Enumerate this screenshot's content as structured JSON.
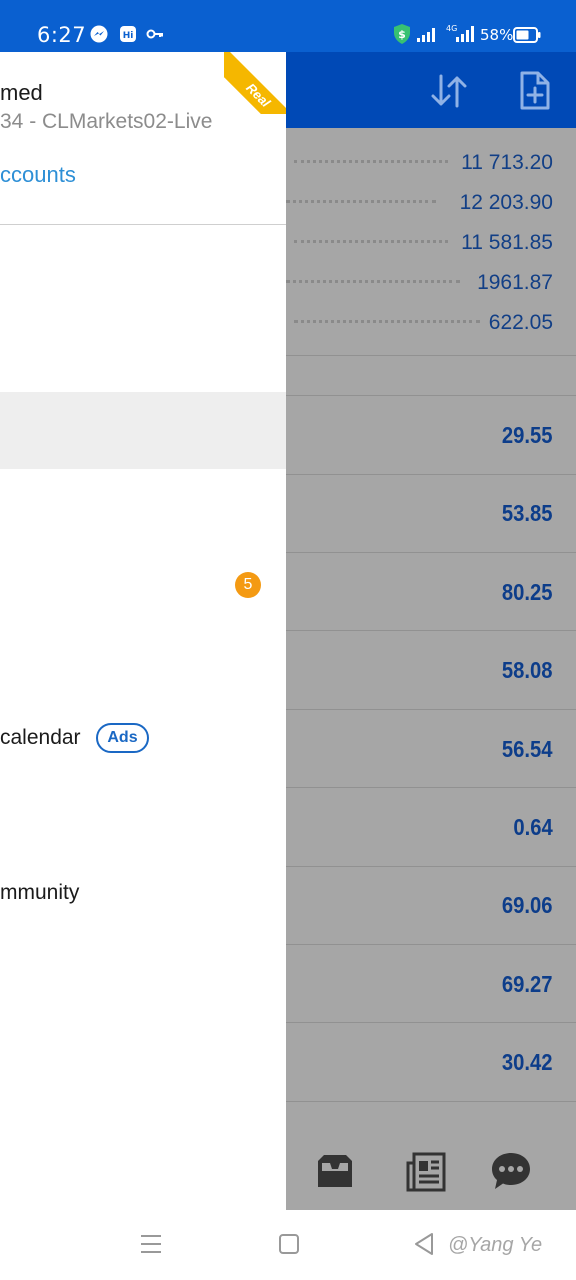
{
  "status_bar": {
    "time": "6:27",
    "battery_percent": "58%",
    "network_label": "4G",
    "icons": [
      "messenger-icon",
      "hi-app-icon",
      "key-icon",
      "shield-dollar-icon",
      "signal-icon",
      "signal-4g-icon",
      "battery-icon"
    ]
  },
  "toolbar": {
    "icons": [
      "sort-icon",
      "add-document-icon"
    ]
  },
  "quotes": [
    {
      "value": "11 713.20"
    },
    {
      "value": "12 203.90"
    },
    {
      "value": "11 581.85"
    },
    {
      "value": "1961.87"
    },
    {
      "value": "622.05"
    }
  ],
  "deals": [
    {
      "value": "29.55"
    },
    {
      "value": "53.85"
    },
    {
      "value": "80.25"
    },
    {
      "value": "58.08"
    },
    {
      "value": "56.54"
    },
    {
      "value": "0.64"
    },
    {
      "value": "69.06"
    },
    {
      "value": "69.27"
    },
    {
      "value": "30.42"
    }
  ],
  "drawer": {
    "ribbon_label": "Real",
    "account_name": "med",
    "account_server": "34 - CLMarkets02-Live",
    "accounts_link": "ccounts",
    "badge_count": "5",
    "menu_items": [
      {
        "label": "calendar"
      },
      {
        "label": "mmunity"
      }
    ],
    "ads_label": "Ads"
  },
  "bottom_nav": {
    "icons": [
      "mailbox-icon",
      "news-icon",
      "chat-icon"
    ]
  },
  "sys_nav": {
    "watermark": "@Yang Ye",
    "icons": [
      "menu-icon",
      "home-icon",
      "back-icon"
    ]
  },
  "colors": {
    "status_bar": "#0a60d0",
    "toolbar": "#0049b6",
    "dim_overlay": "#a6a6a6",
    "quote_text": "#123f86",
    "deal_text": "#0d3d8a",
    "link": "#2d8fd6",
    "badge": "#f49a13",
    "ribbon": "#f5b700"
  }
}
